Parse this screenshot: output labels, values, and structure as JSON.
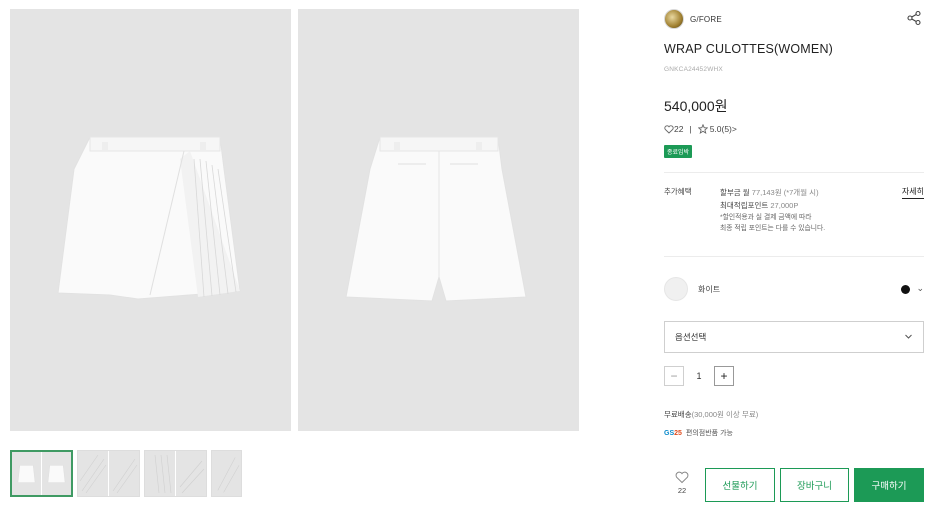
{
  "product": {
    "brand": "G/FORE",
    "title": "WRAP CULOTTES(WOMEN)",
    "code": "GNKCA24452WHX",
    "price": "540,000원",
    "likes": "22",
    "rating": "5.0(5)>",
    "badge": "종료임박"
  },
  "benefit": {
    "label": "추가혜택",
    "installment_prefix": "할부금 월 ",
    "installment_value": "77,143원 (*7개월 시)",
    "points_prefix": "최대적립포인트 ",
    "points_value": "27,000P",
    "note_line1": "*할인적용과 실 결제 금액에 따라",
    "note_line2": "최종 적립 포인트는 다를 수 있습니다.",
    "more": "자세히"
  },
  "color": {
    "name": "화이트",
    "swatch": "#f0f0f0",
    "selected_dot": "#111111"
  },
  "option_select": {
    "label": "옵션선택"
  },
  "quantity": {
    "minus": "−",
    "value": "1",
    "plus": "+"
  },
  "shipping": {
    "label": "무료배송",
    "note": "(30,000원 이상 무료)",
    "gs_logo_text": "GS",
    "gs_logo_num": "25",
    "gs_text": "편의점반품 가능"
  },
  "actions": {
    "like_count": "22",
    "gift": "선물하기",
    "cart": "장바구니",
    "buy": "구매하기"
  },
  "colors": {
    "accent": "#1c9a56",
    "image_bg": "#e4e4e4"
  }
}
